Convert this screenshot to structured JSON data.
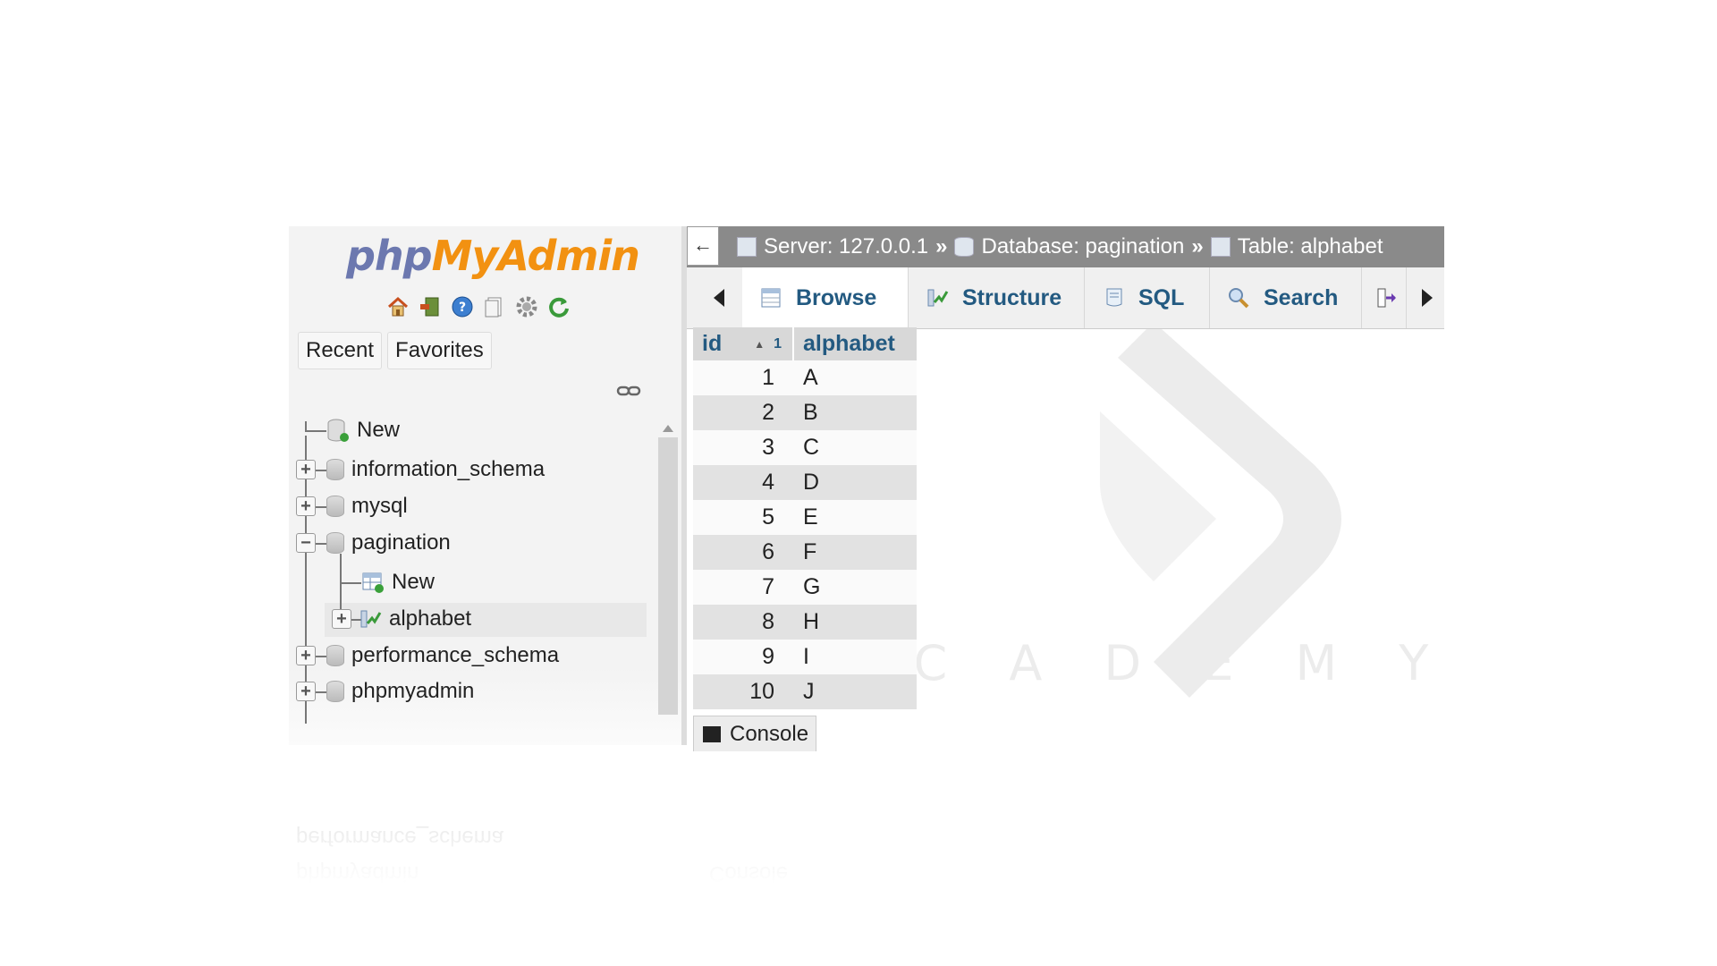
{
  "logo": {
    "part1": "php",
    "part2": "MyAdmin"
  },
  "nav_icons": [
    "home-icon",
    "logout-icon",
    "help-icon",
    "docs-icon",
    "settings-icon",
    "reload-icon"
  ],
  "nav_tabs": {
    "recent": "Recent",
    "favorites": "Favorites"
  },
  "tree": {
    "new_root": "New",
    "databases": [
      "information_schema",
      "mysql",
      "pagination",
      "performance_schema",
      "phpmyadmin"
    ],
    "pagination_new": "New",
    "pagination_table": "alphabet"
  },
  "breadcrumb": {
    "back": "←",
    "server": "Server: 127.0.0.1",
    "database": "Database: pagination",
    "table": "Table: alphabet",
    "separator": "»"
  },
  "tabs": [
    "Browse",
    "Structure",
    "SQL",
    "Search"
  ],
  "grid": {
    "headers": {
      "id": "id",
      "sort_index": "1",
      "alphabet": "alphabet"
    },
    "rows": [
      {
        "id": "1",
        "alphabet": "A"
      },
      {
        "id": "2",
        "alphabet": "B"
      },
      {
        "id": "3",
        "alphabet": "C"
      },
      {
        "id": "4",
        "alphabet": "D"
      },
      {
        "id": "5",
        "alphabet": "E"
      },
      {
        "id": "6",
        "alphabet": "F"
      },
      {
        "id": "7",
        "alphabet": "G"
      },
      {
        "id": "8",
        "alphabet": "H"
      },
      {
        "id": "9",
        "alphabet": "I"
      },
      {
        "id": "10",
        "alphabet": "J"
      }
    ]
  },
  "console": "Console",
  "watermark": "R U   A C A D E M Y",
  "colors": {
    "link": "#235a81",
    "logo_blue": "#6c78af",
    "logo_orange": "#f29111",
    "topbar": "#8a8a8a"
  }
}
